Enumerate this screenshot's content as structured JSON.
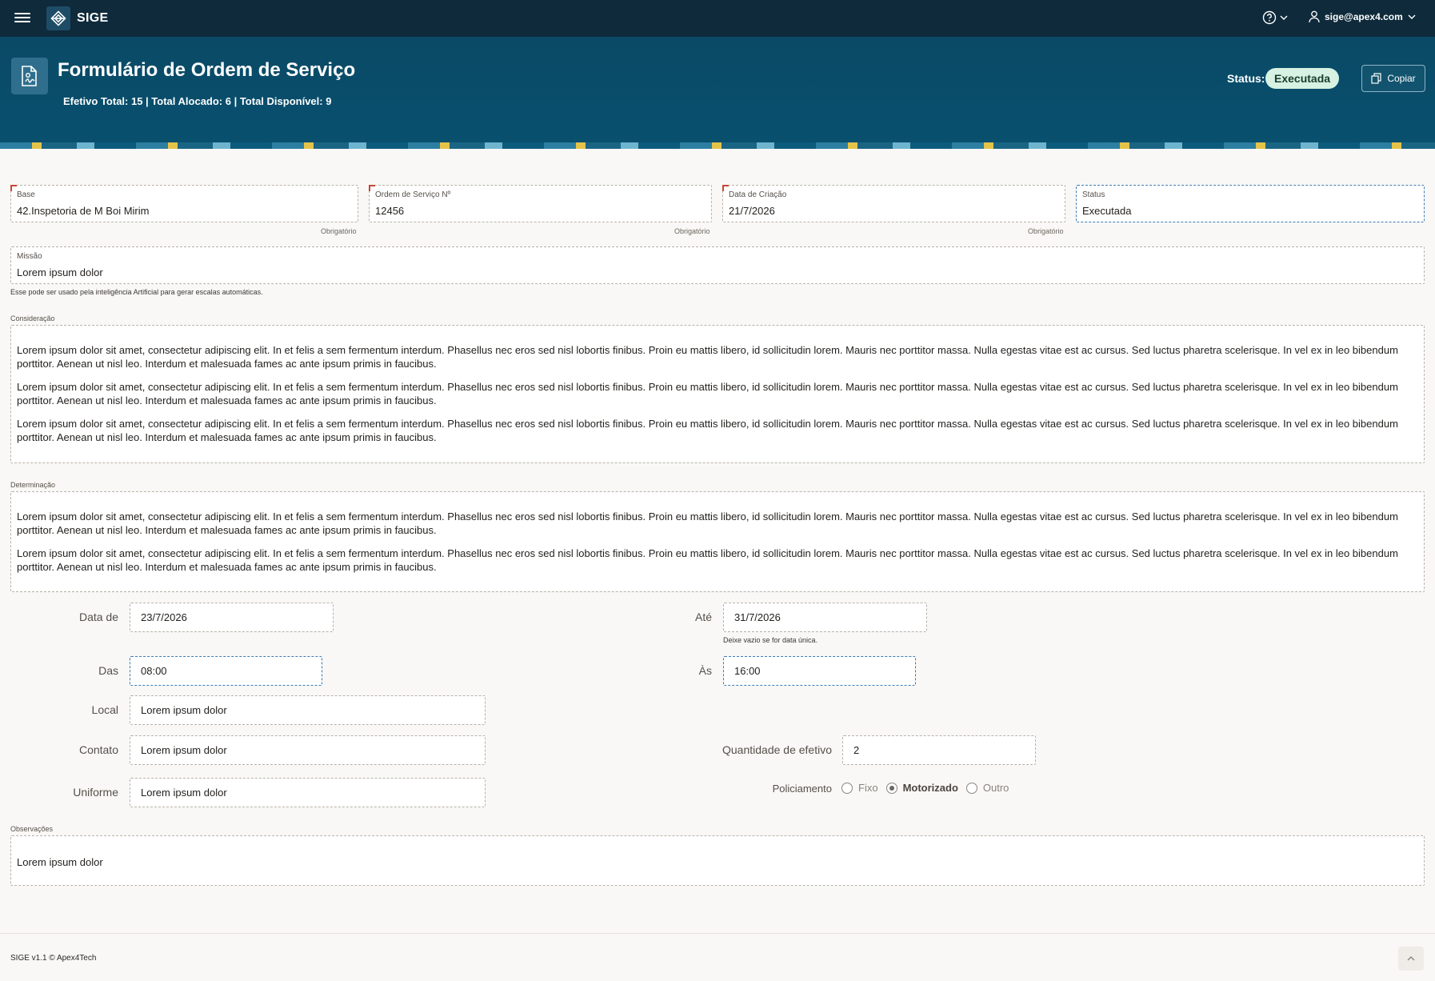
{
  "topbar": {
    "app_name": "SIGE",
    "user_email": "sige@apex4.com"
  },
  "hero": {
    "title": "Formulário de Ordem de Serviço",
    "subtitle": "Efetivo Total: 15 | Total Alocado: 6 | Total Disponível: 9",
    "status_label": "Status:",
    "status_value": "Executada",
    "copy_label": "Copiar"
  },
  "fields": {
    "base": {
      "label": "Base",
      "value": "42.Inspetoria de M Boi Mirim",
      "required_note": "Obrigatório"
    },
    "ordem": {
      "label": "Ordem de Serviço Nº",
      "value": "12456",
      "required_note": "Obrigatório"
    },
    "data_criacao": {
      "label": "Data de Criação",
      "value": "21/7/2026",
      "required_note": "Obrigatório"
    },
    "status": {
      "label": "Status",
      "value": "Executada"
    },
    "missao": {
      "label": "Missão",
      "value": "Lorem ipsum dolor",
      "helper": "Esse pode ser usado pela inteligência Artificial para gerar escalas automáticas."
    }
  },
  "consideracao": {
    "label": "Consideração",
    "paragraphs": [
      "Lorem ipsum dolor sit amet, consectetur adipiscing elit. In et felis a sem fermentum interdum. Phasellus nec eros sed nisl lobortis finibus. Proin eu mattis libero, id sollicitudin lorem. Mauris nec porttitor massa. Nulla egestas vitae est ac cursus. Sed luctus pharetra scelerisque. In vel ex in leo bibendum porttitor. Aenean ut nisl leo. Interdum et malesuada fames ac ante ipsum primis in faucibus.",
      "Lorem ipsum dolor sit amet, consectetur adipiscing elit. In et felis a sem fermentum interdum. Phasellus nec eros sed nisl lobortis finibus. Proin eu mattis libero, id sollicitudin lorem. Mauris nec porttitor massa. Nulla egestas vitae est ac cursus. Sed luctus pharetra scelerisque. In vel ex in leo bibendum porttitor. Aenean ut nisl leo. Interdum et malesuada fames ac ante ipsum primis in faucibus.",
      "Lorem ipsum dolor sit amet, consectetur adipiscing elit. In et felis a sem fermentum interdum. Phasellus nec eros sed nisl lobortis finibus. Proin eu mattis libero, id sollicitudin lorem. Mauris nec porttitor massa. Nulla egestas vitae est ac cursus. Sed luctus pharetra scelerisque. In vel ex in leo bibendum porttitor. Aenean ut nisl leo. Interdum et malesuada fames ac ante ipsum primis in faucibus."
    ]
  },
  "determinacao": {
    "label": "Determinação",
    "paragraphs": [
      "Lorem ipsum dolor sit amet, consectetur adipiscing elit. In et felis a sem fermentum interdum. Phasellus nec eros sed nisl lobortis finibus. Proin eu mattis libero, id sollicitudin lorem. Mauris nec porttitor massa. Nulla egestas vitae est ac cursus. Sed luctus pharetra scelerisque. In vel ex in leo bibendum porttitor. Aenean ut nisl leo. Interdum et malesuada fames ac ante ipsum primis in faucibus.",
      "Lorem ipsum dolor sit amet, consectetur adipiscing elit. In et felis a sem fermentum interdum. Phasellus nec eros sed nisl lobortis finibus. Proin eu mattis libero, id sollicitudin lorem. Mauris nec porttitor massa. Nulla egestas vitae est ac cursus. Sed luctus pharetra scelerisque. In vel ex in leo bibendum porttitor. Aenean ut nisl leo. Interdum et malesuada fames ac ante ipsum primis in faucibus."
    ]
  },
  "schedule": {
    "data_de": {
      "label": "Data de",
      "value": "23/7/2026"
    },
    "ate": {
      "label": "Até",
      "value": "31/7/2026",
      "helper": "Deixe vazio se for data única."
    },
    "das": {
      "label": "Das",
      "value": "08:00"
    },
    "as": {
      "label": "Às",
      "value": "16:00"
    },
    "local": {
      "label": "Local",
      "value": "Lorem ipsum dolor"
    },
    "contato": {
      "label": "Contato",
      "value": "Lorem ipsum dolor"
    },
    "uniforme": {
      "label": "Uniforme",
      "value": "Lorem ipsum dolor"
    },
    "quantidade": {
      "label": "Quantidade de efetivo",
      "value": "2"
    },
    "policiamento": {
      "label": "Policiamento",
      "options": [
        "Fixo",
        "Motorizado",
        "Outro"
      ],
      "selected": "Motorizado"
    }
  },
  "observacoes": {
    "label": "Observações",
    "value": "Lorem ipsum dolor"
  },
  "footer": {
    "text": "SIGE v1.1 © Apex4Tech"
  },
  "colors": {
    "topbar": "#0e2a3b",
    "hero": "#08506f",
    "status_badge": "#d7f1e3",
    "required": "#c74634"
  }
}
